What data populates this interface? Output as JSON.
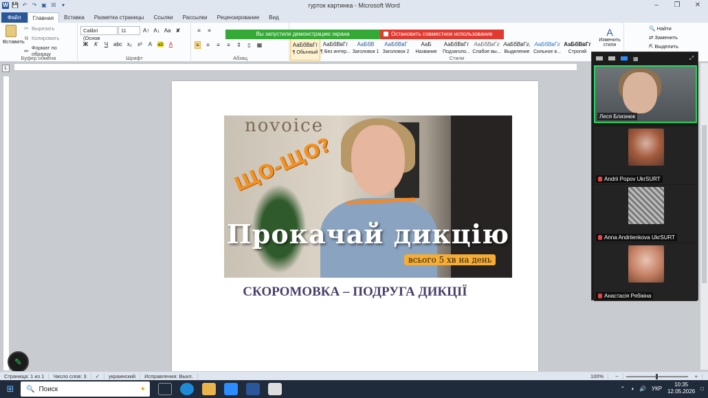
{
  "window": {
    "title": "гурток картинка - Microsoft Word"
  },
  "tabs": [
    "Файл",
    "Главная",
    "Вставка",
    "Разметка страницы",
    "Ссылки",
    "Рассылки",
    "Рецензирование",
    "Вид"
  ],
  "active_tab": "Главная",
  "ribbon": {
    "clipboard": {
      "paste": "Вставить",
      "cut": "Вырезать",
      "copy": "Копировать",
      "format_painter": "Формат по образцу",
      "label": "Буфер обмена"
    },
    "font": {
      "name": "Calibri (Основ",
      "size": "11",
      "label": "Шрифт"
    },
    "paragraph": {
      "label": "Абзац"
    },
    "styles": {
      "label": "Стили",
      "items": [
        {
          "sample": "АаБбВвГг",
          "name": "¶ Обычный"
        },
        {
          "sample": "АаБбВвГг",
          "name": "¶ Без интер..."
        },
        {
          "sample": "АаБбВ",
          "name": "Заголовок 1"
        },
        {
          "sample": "АаБбВвГ",
          "name": "Заголовок 2"
        },
        {
          "sample": "АаБ",
          "name": "Название"
        },
        {
          "sample": "АаБбВвГг",
          "name": "Подзаголо..."
        },
        {
          "sample": "АаБбВвГг",
          "name": "Слабое вы..."
        },
        {
          "sample": "АаБбВвГг,",
          "name": "Выделение"
        },
        {
          "sample": "АаБбВвГг",
          "name": "Сильное в..."
        },
        {
          "sample": "АаБбВвГг",
          "name": "Строгий"
        }
      ],
      "change_styles": "Изменить стили"
    },
    "editing": {
      "find": "Найти",
      "replace": "Заменить",
      "select": "Выделить"
    }
  },
  "share": {
    "status": "Вы запустили демонстрацию экрана",
    "stop": "Остановить совместное использование"
  },
  "document": {
    "image_text": {
      "wall_logo": "novoice",
      "exclaim": "ЩО-ЩО?",
      "headline": "Прокачай дикцію",
      "badge": "всього 5 хв на день"
    },
    "caption": "СКОРОМОВКА – ПОДРУГА ДИКЦІЇ"
  },
  "zoom": {
    "participants": [
      {
        "name": "Леся Близнюк",
        "speaking": true
      },
      {
        "name": "Andrii Popov UkrSURT",
        "muted": true
      },
      {
        "name": "Anna Andriienkova UkrSURT",
        "muted": true
      },
      {
        "name": "Анастасія Рябікіна",
        "muted": true
      }
    ]
  },
  "statusbar": {
    "page": "Страница: 1 из 1",
    "words": "Число слов: 3",
    "language": "украинский",
    "track_changes": "Исправления: Выкл.",
    "zoom": "100%"
  },
  "taskbar": {
    "search": "Поиск",
    "lang": "УКР",
    "time": "10:35",
    "date": "12.05.2026"
  }
}
